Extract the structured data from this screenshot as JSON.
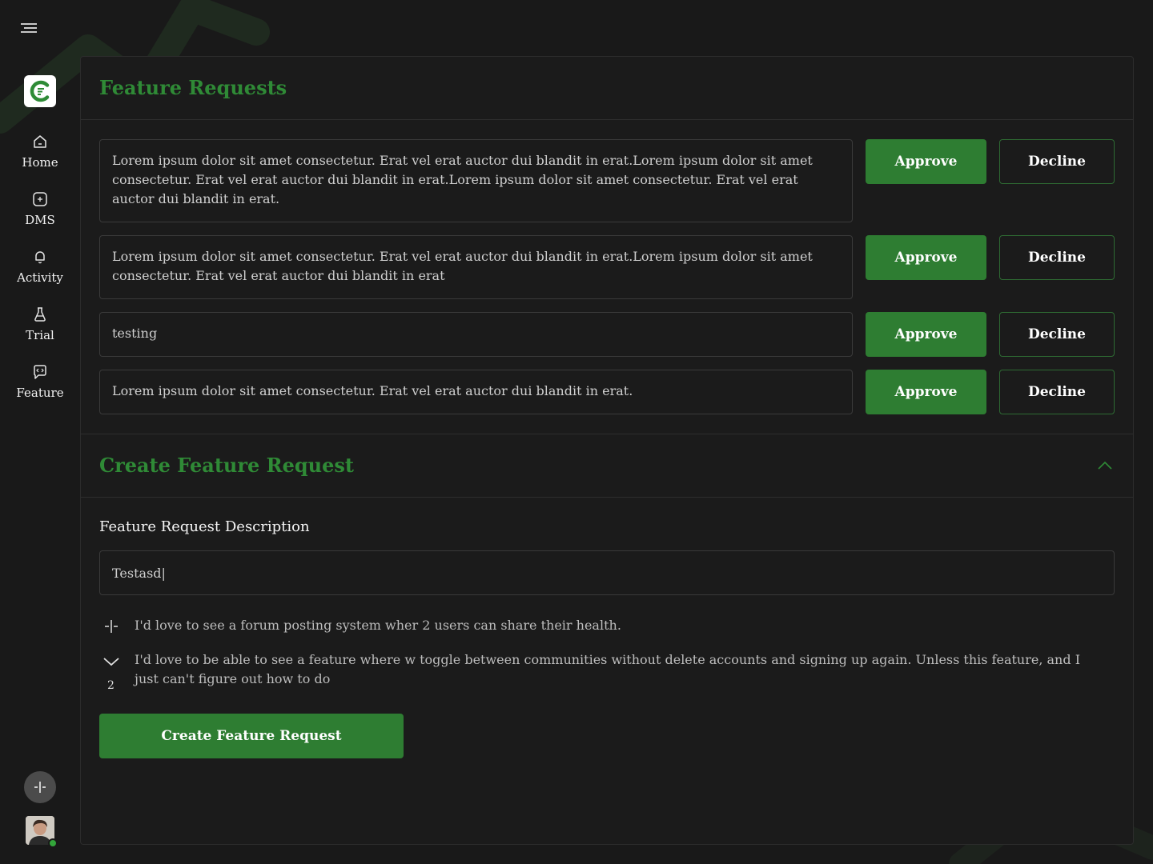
{
  "sidebar": {
    "items": [
      {
        "label": "Home",
        "icon": "home-icon"
      },
      {
        "label": "DMS",
        "icon": "message-plus-icon"
      },
      {
        "label": "Activity",
        "icon": "bell-icon"
      },
      {
        "label": "Trial",
        "icon": "flask-icon"
      },
      {
        "label": "Feature",
        "icon": "code-chat-icon"
      }
    ]
  },
  "feature_requests": {
    "title": "Feature Requests",
    "approve_label": "Approve",
    "decline_label": "Decline",
    "items": [
      {
        "text": "Lorem ipsum dolor sit amet consectetur. Erat vel erat auctor dui blandit in erat.Lorem ipsum dolor sit amet consectetur. Erat vel erat auctor dui blandit in erat.Lorem ipsum dolor sit amet consectetur. Erat vel erat auctor dui blandit in erat."
      },
      {
        "text": "Lorem ipsum dolor sit amet consectetur. Erat vel erat auctor dui blandit in erat.Lorem ipsum dolor sit amet consectetur. Erat vel erat auctor dui blandit in erat"
      },
      {
        "text": "testing"
      },
      {
        "text": "Lorem ipsum dolor sit amet consectetur. Erat vel erat auctor dui blandit in erat."
      }
    ]
  },
  "create": {
    "title": "Create Feature Request",
    "field_label": "Feature Request Description",
    "input_value": "Testasd|",
    "suggestions": [
      {
        "text": "I'd love to see a forum posting system wher 2 users can share their health."
      },
      {
        "text": "I'd love to be able to see a feature where w toggle between communities without delete accounts and signing up again. Unless this feature, and I just can't figure out how to do",
        "votes": "2"
      }
    ],
    "button_label": "Create Feature Request"
  },
  "colors": {
    "accent": "#2e7d32",
    "heading_green": "#2f8a36",
    "background": "#191919"
  }
}
